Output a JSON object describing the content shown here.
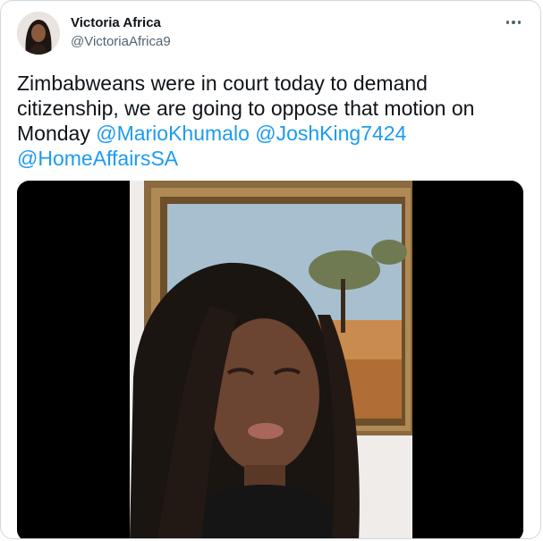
{
  "tweet": {
    "author_name": "Victoria Africa",
    "author_handle": "@VictoriaAfrica9",
    "more_icon": "more-horizontal-icon",
    "text_main": "Zimbabweans were in court today to demand citizenship, we are going to oppose that motion on Monday",
    "mentions": [
      "@MarioKhumalo",
      "@JoshKing7424",
      "@HomeAffairsSA"
    ],
    "media_type": "video"
  },
  "colors": {
    "text": "#0f1419",
    "secondary": "#536471",
    "link": "#1d9bf0",
    "border": "#cfd9de"
  }
}
